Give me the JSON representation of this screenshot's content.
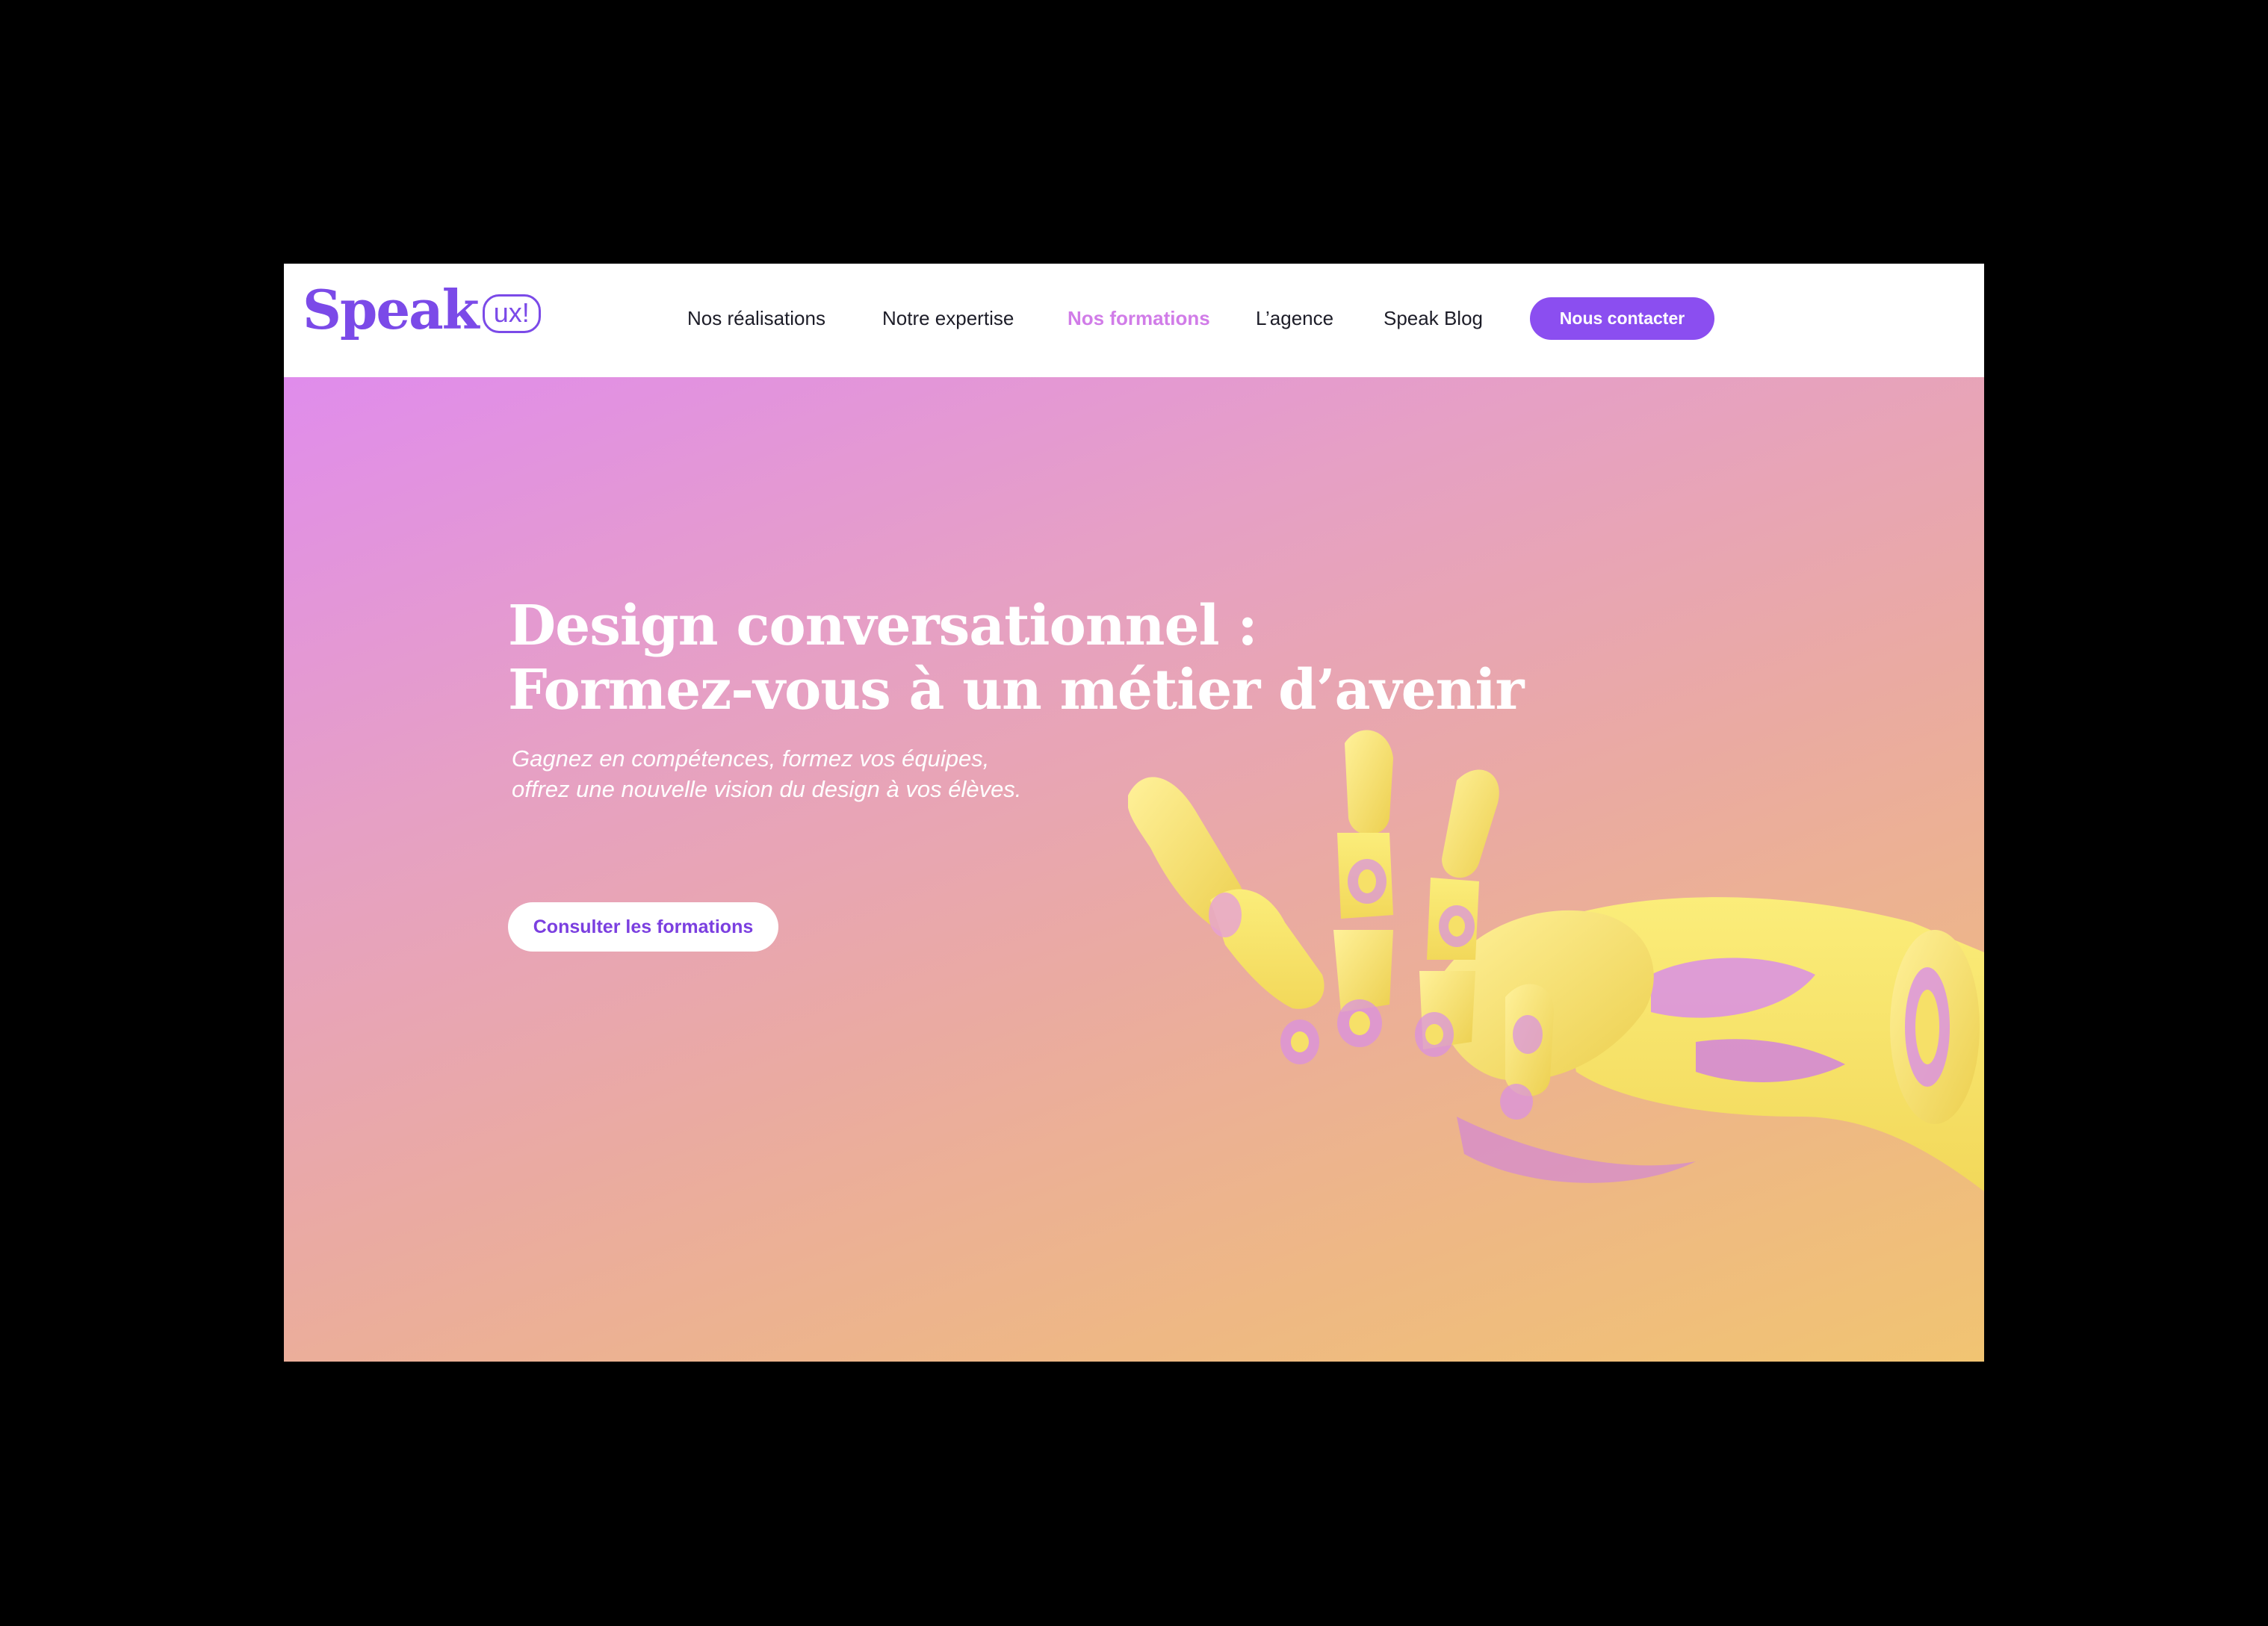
{
  "logo": {
    "word": "Speak",
    "bubble": "ux!"
  },
  "nav": {
    "items": [
      {
        "label": "Nos réalisations",
        "active": false
      },
      {
        "label": "Notre expertise",
        "active": false
      },
      {
        "label": "Nos formations",
        "active": true
      },
      {
        "label": "L’agence",
        "active": false
      },
      {
        "label": "Speak Blog",
        "active": false
      }
    ],
    "contact_label": "Nous contacter"
  },
  "hero": {
    "title_line1": "Design conversationnel :",
    "title_line2": "Formez-vous à un métier d’avenir",
    "subtitle_line1": "Gagnez en compétences, formez vos équipes,",
    "subtitle_line2": "offrez une nouvelle vision du design à vos élèves.",
    "cta_label": "Consulter les formations",
    "image": "robot-hand-illustration"
  },
  "colors": {
    "brand_purple": "#8b4ef0",
    "active_nav": "#d17ce8",
    "gradient_top": "#e08cec",
    "gradient_bottom": "#f1c472",
    "hand_yellow": "#f6e068",
    "backdrop": "#000000"
  }
}
